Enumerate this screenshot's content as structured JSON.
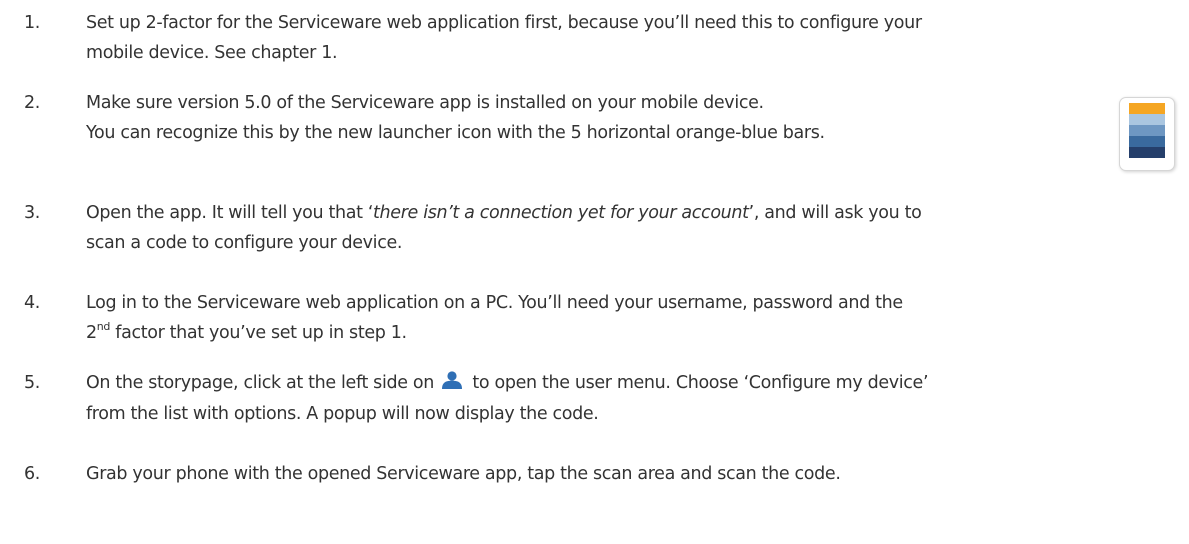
{
  "steps": [
    {
      "number": "1.",
      "lines": [
        "Set up 2-factor for the Serviceware web application first, because you’ll need this to configure your",
        "mobile device. See chapter 1."
      ]
    },
    {
      "number": "2.",
      "lines": [
        "Make sure version 5.0 of the Serviceware app is installed on your mobile device.",
        "You can recognize this by the new launcher icon with the 5 horizontal orange-blue bars."
      ]
    },
    {
      "number": "3.",
      "line1_pre": "Open the app. It will tell you that ‘",
      "line1_em": "there isn’t a connection yet for your account",
      "line1_post": "’, and will ask you to",
      "line2": "scan a code to configure your device."
    },
    {
      "number": "4.",
      "line1": "Log in to the Serviceware web application on a PC. You’ll need your username, password and the",
      "line2_pre": "2",
      "line2_sup": "nd",
      "line2_post": " factor that you’ve set up in step 1."
    },
    {
      "number": "5.",
      "line1_pre": "On the storypage, click at the left side on",
      "line1_post": "to open the user menu. Choose ‘Configure my device’",
      "line2": "from the list with options. A popup will now display the code."
    },
    {
      "number": "6.",
      "line1": "Grab your phone with the opened Serviceware app, tap the scan area and scan the code."
    }
  ],
  "launcher_icon": {
    "name": "serviceware-launcher-icon",
    "bar_colors": [
      "#f5a623",
      "#aac6e0",
      "#6e97c2",
      "#3a6a9e",
      "#253f6b"
    ]
  },
  "user_icon": {
    "name": "user-icon",
    "color": "#2f6fb5"
  }
}
